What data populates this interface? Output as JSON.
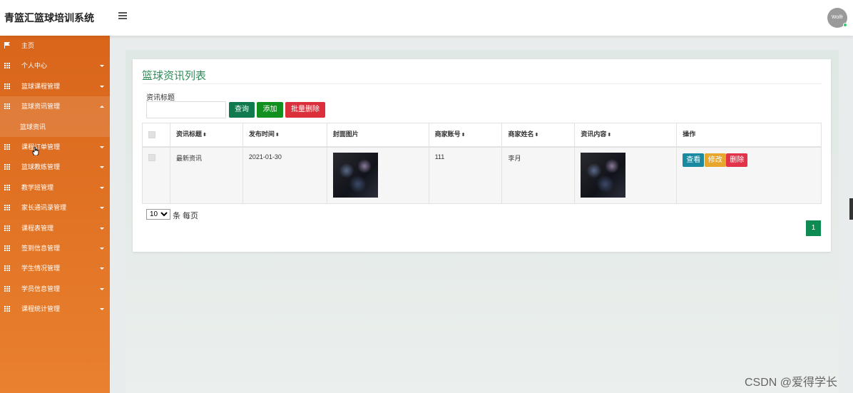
{
  "app": {
    "title": "青篮汇篮球培训系统",
    "avatar_text": "Wolfr"
  },
  "sidebar": {
    "items": [
      {
        "label": "主页",
        "icon": "flag-icon",
        "caret": ""
      },
      {
        "label": "个人中心",
        "icon": "grid-icon",
        "caret": "down"
      },
      {
        "label": "篮球课程管理",
        "icon": "grid-icon",
        "caret": "down"
      },
      {
        "label": "篮球资讯管理",
        "icon": "grid-icon",
        "caret": "up"
      },
      {
        "label": "篮球资讯",
        "icon": "",
        "caret": ""
      },
      {
        "label": "课程订单管理",
        "icon": "grid-icon",
        "caret": "down"
      },
      {
        "label": "篮球教练管理",
        "icon": "grid-icon",
        "caret": "down"
      },
      {
        "label": "教学班管理",
        "icon": "grid-icon",
        "caret": "down"
      },
      {
        "label": "家长通讯录管理",
        "icon": "grid-icon",
        "caret": "down"
      },
      {
        "label": "课程表管理",
        "icon": "grid-icon",
        "caret": "down"
      },
      {
        "label": "签到信息管理",
        "icon": "grid-icon",
        "caret": "down"
      },
      {
        "label": "学生情况管理",
        "icon": "grid-icon",
        "caret": "down"
      },
      {
        "label": "学员信息管理",
        "icon": "grid-icon",
        "caret": "down"
      },
      {
        "label": "课程统计管理",
        "icon": "grid-icon",
        "caret": "down"
      }
    ]
  },
  "main": {
    "title": "篮球资讯列表",
    "search": {
      "label": "资讯标题",
      "value": "",
      "placeholder": ""
    },
    "buttons": {
      "query": "查询",
      "add": "添加",
      "batch_delete": "批量删除"
    },
    "table": {
      "columns": [
        "资讯标题",
        "发布时间",
        "封面图片",
        "商家账号",
        "商家姓名",
        "资讯内容",
        "操作"
      ],
      "rows": [
        {
          "title": "最新资讯",
          "date": "2021-01-30",
          "account": "111",
          "name": "李月"
        }
      ],
      "actions": {
        "view": "查看",
        "edit": "修改",
        "delete": "删除"
      }
    },
    "pagination": {
      "page_size": "10",
      "page_size_suffix": "条 每页",
      "current_page": "1"
    }
  },
  "watermark": "CSDN @爱得学长",
  "colors": {
    "sidebar": "#e07225",
    "accent": "#2e8b57",
    "danger": "#dc2f3c"
  }
}
